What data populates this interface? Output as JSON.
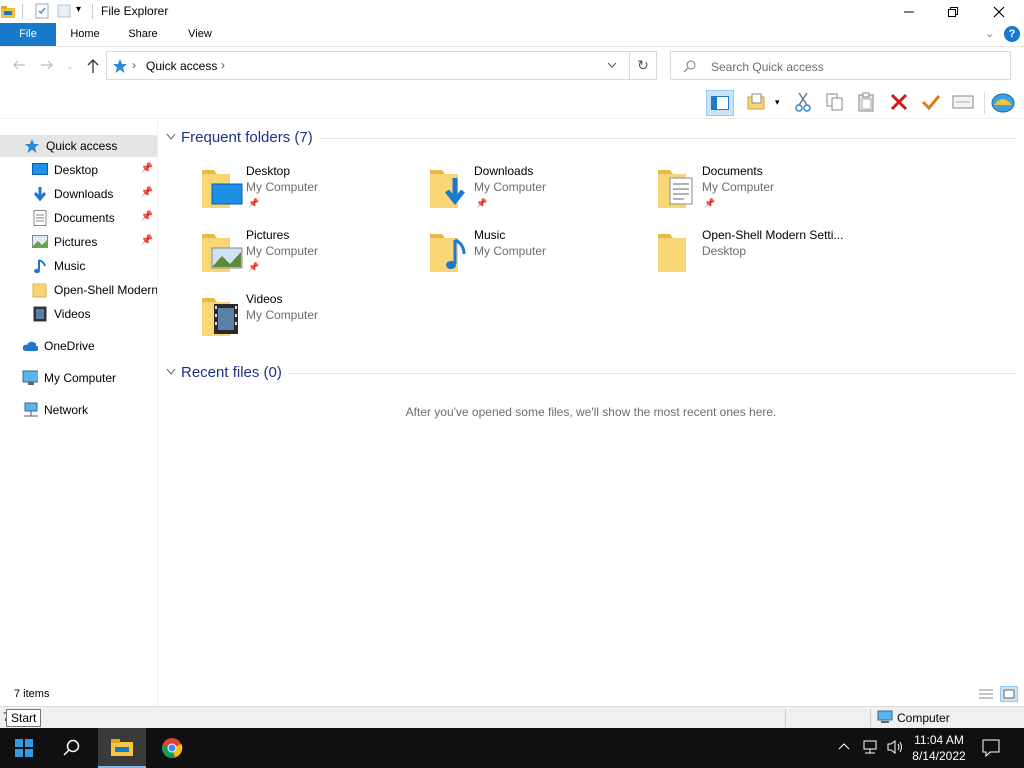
{
  "window": {
    "title": "File Explorer"
  },
  "ribbon": {
    "tabs": [
      {
        "label": "File"
      },
      {
        "label": "Home"
      },
      {
        "label": "Share"
      },
      {
        "label": "View"
      }
    ]
  },
  "address": {
    "crumb": "Quick access",
    "search_placeholder": "Search Quick access"
  },
  "nav": {
    "items": [
      {
        "label": "Quick access"
      },
      {
        "label": "Desktop"
      },
      {
        "label": "Downloads"
      },
      {
        "label": "Documents"
      },
      {
        "label": "Pictures"
      },
      {
        "label": "Music"
      },
      {
        "label": "Open-Shell Modern"
      },
      {
        "label": "Videos"
      },
      {
        "label": "OneDrive"
      },
      {
        "label": "My Computer"
      },
      {
        "label": "Network"
      }
    ]
  },
  "content": {
    "frequent_header": "Frequent folders (7)",
    "recent_header": "Recent files (0)",
    "recent_empty": "After you've opened some files, we'll show the most recent ones here.",
    "folders": [
      {
        "name": "Desktop",
        "location": "My Computer"
      },
      {
        "name": "Downloads",
        "location": "My Computer"
      },
      {
        "name": "Documents",
        "location": "My Computer"
      },
      {
        "name": "Pictures",
        "location": "My Computer"
      },
      {
        "name": "Music",
        "location": "My Computer"
      },
      {
        "name": "Open-Shell Modern Setti...",
        "location": "Desktop"
      },
      {
        "name": "Videos",
        "location": "My Computer"
      }
    ]
  },
  "status": {
    "items": "7 items",
    "tooltip": "Start",
    "computer": "Computer"
  },
  "taskbar": {
    "time": "11:04 AM",
    "date": "8/14/2022"
  },
  "colors": {
    "accent": "#1979ca",
    "section": "#1e3287",
    "folder": "#f8d675",
    "taskbar": "#101010"
  }
}
